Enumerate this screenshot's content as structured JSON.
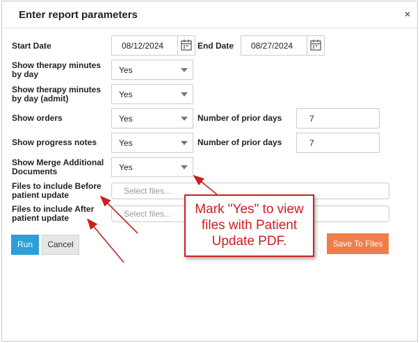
{
  "dialog": {
    "title": "Enter report parameters",
    "close_glyph": "×"
  },
  "form": {
    "start_date_label": "Start Date",
    "start_date_value": "08/12/2024",
    "end_date_label": "End Date",
    "end_date_value": "08/27/2024",
    "therapy_by_day_label": "Show therapy minutes by day",
    "therapy_by_day_value": "Yes",
    "therapy_admit_label": "Show therapy minutes by day (admit)",
    "therapy_admit_value": "Yes",
    "orders_label": "Show orders",
    "orders_value": "Yes",
    "orders_prior_days_label": "Number of prior days",
    "orders_prior_days_value": "7",
    "progress_notes_label": "Show progress notes",
    "progress_notes_value": "Yes",
    "progress_prior_days_label": "Number of prior days",
    "progress_prior_days_value": "7",
    "merge_docs_label": "Show Merge Additional Documents",
    "merge_docs_value": "Yes",
    "files_before_label": "Files to include Before patient update",
    "files_before_placeholder": "Select files...",
    "files_after_label": "Files to include After patient update",
    "files_after_placeholder": "Select files..."
  },
  "buttons": {
    "run": "Run",
    "cancel": "Cancel",
    "save_to_files": "Save To Files"
  },
  "annotation": {
    "callout_text": "Mark \"Yes\" to view files with Patient Update PDF."
  },
  "colors": {
    "run_button": "#2a9fd8",
    "save_button": "#ef7f4a",
    "annotation_red": "#cc1f1f"
  }
}
